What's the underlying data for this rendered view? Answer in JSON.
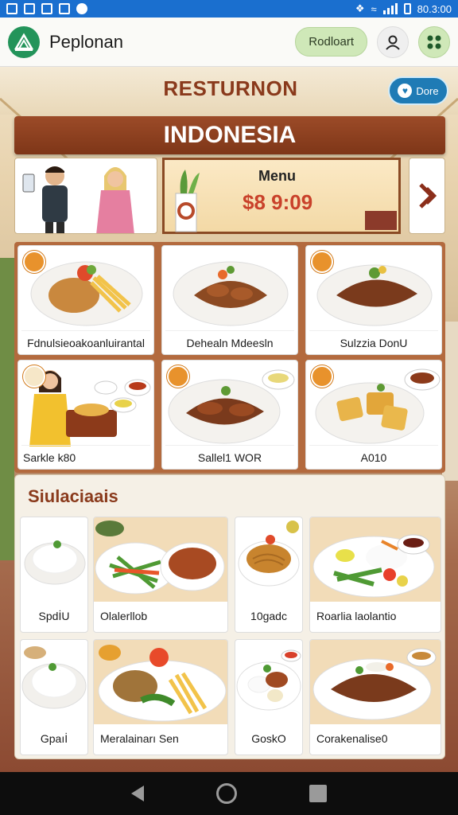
{
  "status_bar": {
    "time": "80.3:00"
  },
  "app": {
    "title": "Peplonan",
    "action_label": "Rodloart"
  },
  "scene": {
    "sign": "RESTURNON",
    "language_button": "Dore",
    "banner": "INDONESIA",
    "menu_board": {
      "label": "Menu",
      "price": "$8 9:09"
    }
  },
  "dishes": [
    {
      "name": "Fdnulsieoakoanluirantal"
    },
    {
      "name": "Dehealn Mdeesln"
    },
    {
      "name": "Sulzzia DonU"
    },
    {
      "name": "Sarkle k80"
    },
    {
      "name": "Sallel1 WOR"
    },
    {
      "name": "A010"
    }
  ],
  "similar": {
    "title": "Siulaciaais",
    "items": [
      {
        "name": "SpdİU"
      },
      {
        "name": "Olalerllob"
      },
      {
        "name": "10gadc"
      },
      {
        "name": "Roarlia laolantio"
      },
      {
        "name": "Gpаıİ"
      },
      {
        "name": "Meralainarı Sen"
      },
      {
        "name": "GoskO"
      },
      {
        "name": "Corakenalise0"
      }
    ]
  },
  "colors": {
    "brand_green": "#23945a",
    "banner_brown": "#8a3a1c",
    "accent_blue": "#1f7bb5",
    "price_red": "#c9412a"
  }
}
